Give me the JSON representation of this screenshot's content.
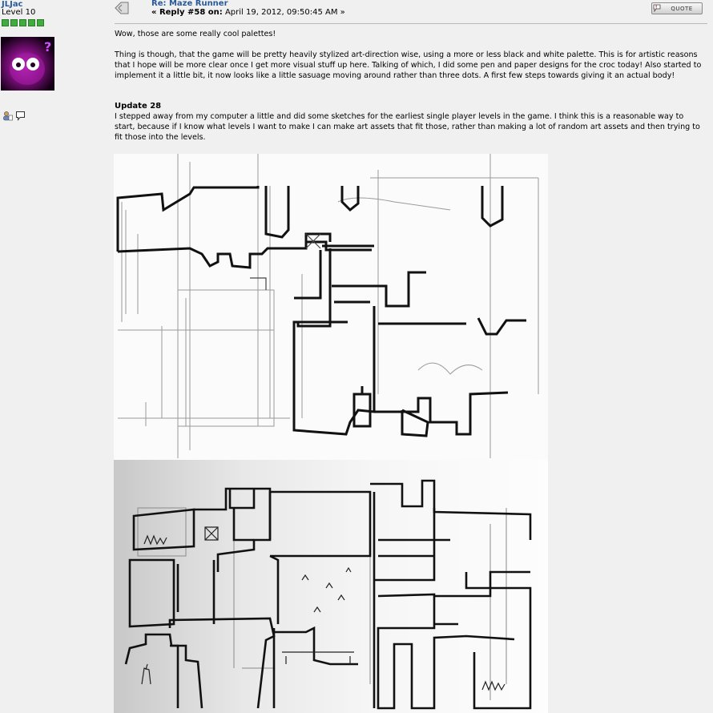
{
  "poster": {
    "username": "JLJac",
    "level": "Level 10",
    "star_color": "#3fae3f"
  },
  "post": {
    "title": "Re: Maze Runner",
    "reply_prefix": "« Reply #58 on:",
    "date": "April 19, 2012, 09:50:45 AM »",
    "quote_label": "QUOTE",
    "paragraph1": "Wow, those are some really cool palettes!",
    "paragraph2": "Thing is though, that the game will be pretty heavily stylized art-direction wise, using a more or less black and white palette. This is for artistic reasons that I hope will be more clear once I get more visual stuff up here. Talking of which, I did some pen and paper designs for the croc today! Also started to implement it a little bit, it now looks like a little sasuage moving around rather than three dots. A first few steps towards giving it an actual body!",
    "update_heading": "Update 28",
    "paragraph3": "I stepped away from my computer a little and did some sketches for the earliest single player levels in the game. I think this is a reasonable way to start, because if I know what levels I want to make I can make art assets that fit those, rather than making a lot of random art assets and then trying to fit those into the levels."
  },
  "colors": {
    "link": "#2a5a9a",
    "background": "#f0f0f0"
  },
  "icons": [
    "post-icon",
    "profile-icon",
    "message-icon",
    "quote-icon"
  ]
}
